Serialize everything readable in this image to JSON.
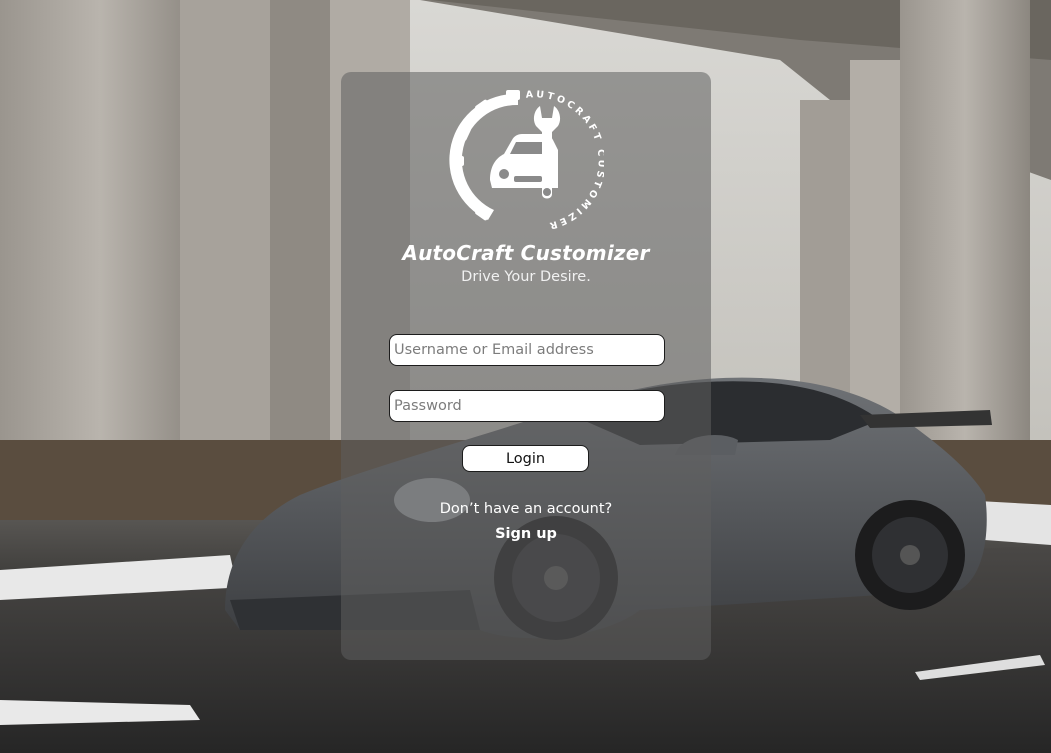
{
  "brand": {
    "logo_text": "AUTOCRAFT CUSTOMIZER",
    "title": "AutoCraft Customizer",
    "tagline": "Drive Your Desire."
  },
  "login_form": {
    "username_placeholder": "Username or Email address",
    "password_placeholder": "Password",
    "login_label": "Login"
  },
  "signup": {
    "prompt": "Don’t have an account?",
    "link_label": "Sign up"
  },
  "colors": {
    "card_overlay": "rgba(95,95,95,0.55)",
    "text": "#ffffff",
    "input_bg": "#ffffff",
    "input_border": "#1c1c1c",
    "car_body": "#5e6165",
    "asphalt": "#2e2e2e",
    "concrete": "#a8a39c"
  },
  "icons": {
    "logo": "gear-car-wrench-logo"
  }
}
